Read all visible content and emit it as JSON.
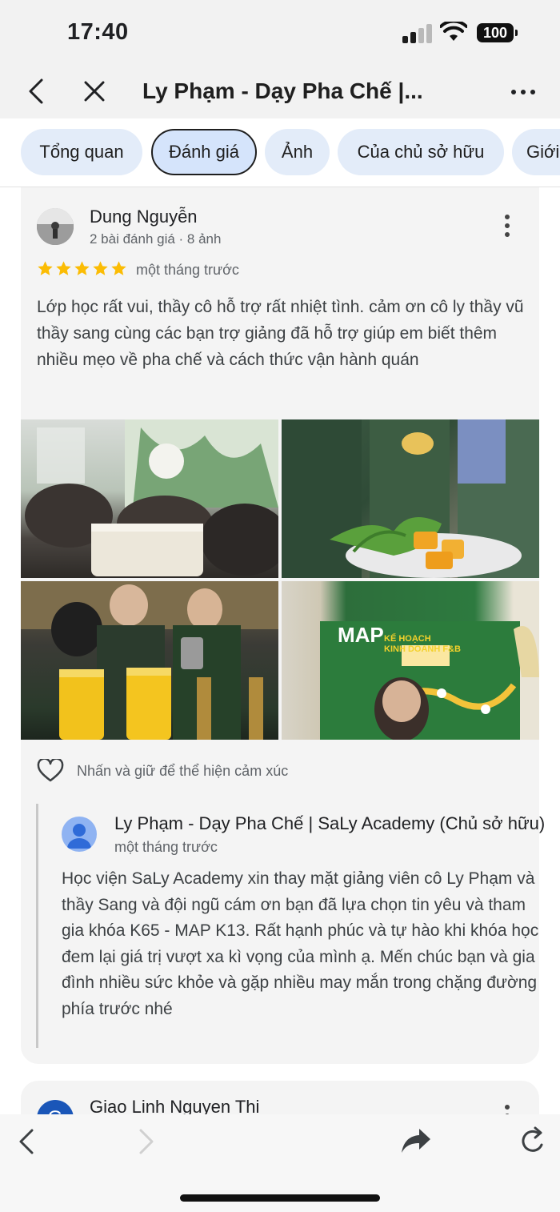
{
  "status_bar": {
    "time": "17:40",
    "battery": "100",
    "icons": [
      "signal-icon",
      "wifi-icon",
      "battery-icon"
    ]
  },
  "header": {
    "title": "Ly Phạm - Dạy Pha Chế |...",
    "icons": [
      "back-arrow-icon",
      "close-icon",
      "more-horizontal-icon"
    ]
  },
  "tabs": [
    {
      "label": "Tổng quan",
      "active": false
    },
    {
      "label": "Đánh giá",
      "active": true
    },
    {
      "label": "Ảnh",
      "active": false
    },
    {
      "label": "Của chủ sở hữu",
      "active": false
    },
    {
      "label": "Giới",
      "active": false
    }
  ],
  "reviews": [
    {
      "author": "Dung Nguyễn",
      "meta": "2 bài đánh giá · 8 ảnh",
      "rating": 5,
      "date": "một tháng trước",
      "text": "Lớp học rất vui, thầy cô hỗ trợ rất nhiệt tình. cảm ơn cô ly thầy vũ thầy sang cùng các bạn trợ giảng đã hỗ trợ giúp em biết thêm nhiều mẹo về pha chế và cách thức vận hành quán",
      "photos": [
        "classroom-photo",
        "dessert-photo",
        "drinks-photo",
        "presentation-photo"
      ],
      "photo_sign": "MAP",
      "photo_sign_sub": "KẾ HOẠCH\nKINH DOANH F&B",
      "reaction_hint": "Nhấn và giữ để thể hiện cảm xúc",
      "owner_reply": {
        "name": "Ly Phạm - Dạy Pha Chế | SaLy Academy (Chủ sở hữu)",
        "date": "một tháng trước",
        "text": "Học viện SaLy Academy xin thay mặt giảng viên cô Ly Phạm và thầy Sang và đội ngũ cám ơn bạn đã lựa chọn tin yêu và tham gia khóa K65 - MAP K13. Rất hạnh phúc và tự hào khi khóa học đem lại giá trị vượt xa kì vọng của mình ạ. Mến chúc bạn và gia đình nhiều sức khỏe và gặp nhiều may mắn trong chặng đường phía trước nhé"
      }
    },
    {
      "author": "Giao Linh Nguyen Thi",
      "avatar_letter": "G"
    }
  ],
  "bottom_bar": {
    "icons": [
      "back-icon",
      "forward-icon",
      "share-icon",
      "reload-icon"
    ]
  },
  "colors": {
    "star": "#fbbc04",
    "chip_bg": "#e3ecf9",
    "chip_active_bg": "#d5e4fb",
    "card_bg": "#f4f4f4",
    "owner_avatar": "#8fb3f2"
  }
}
